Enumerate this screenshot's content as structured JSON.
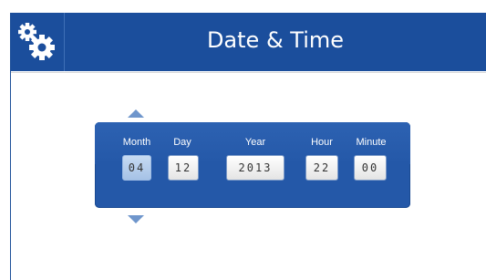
{
  "header": {
    "title": "Date & Time",
    "icon": "gears-icon",
    "color": "#1b4e9c"
  },
  "picker": {
    "fields": [
      {
        "label": "Month",
        "value": "04",
        "selected": true
      },
      {
        "label": "Day",
        "value": "12",
        "selected": false
      },
      {
        "label": "Year",
        "value": "2013",
        "selected": false
      },
      {
        "label": "Hour",
        "value": "22",
        "selected": false
      },
      {
        "label": "Minute",
        "value": "00",
        "selected": false
      }
    ],
    "increment_icon": "arrow-up-icon",
    "decrement_icon": "arrow-down-icon",
    "panel_color": "#2458a8",
    "arrow_color": "#6f96cc"
  }
}
